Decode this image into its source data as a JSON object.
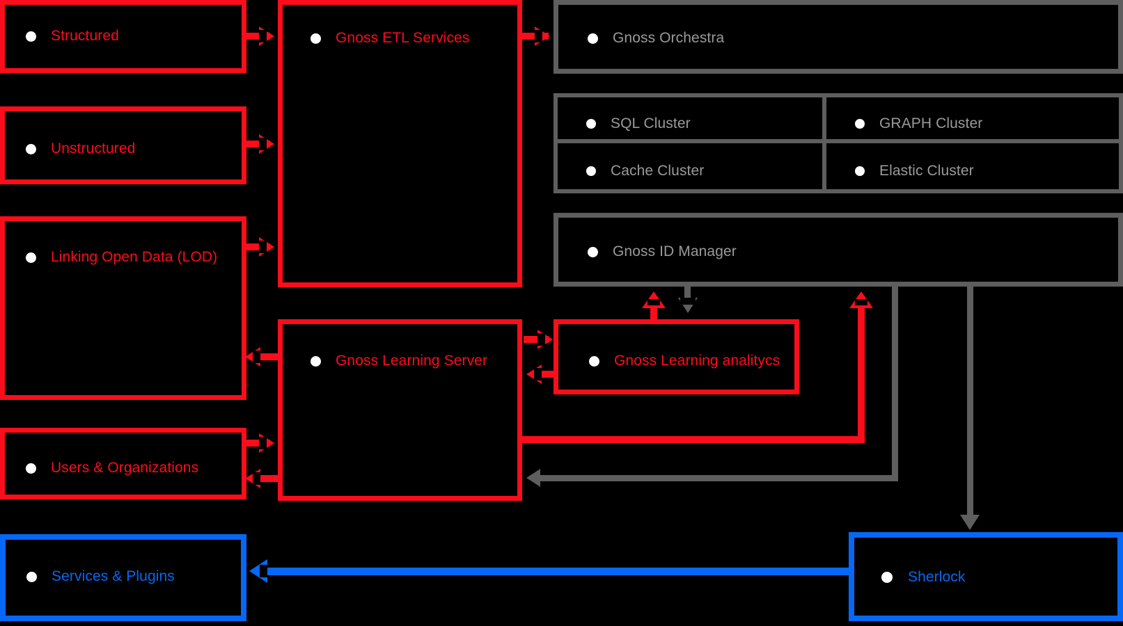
{
  "diagram": {
    "title": "Gnoss platform architecture",
    "background": "#000000",
    "colors": {
      "red": "#fb0d1b",
      "gray": "#5e5e5e",
      "gray_label": "#9a9a9a",
      "blue": "#0668f5",
      "bullet_fill": "#ffffff"
    }
  },
  "nodes": [
    {
      "id": "structured",
      "label": "Structured",
      "color": "red",
      "bullet": "filled-dot-icon"
    },
    {
      "id": "unstructured",
      "label": "Unstructured",
      "color": "red",
      "bullet": "filled-dot-icon"
    },
    {
      "id": "lod",
      "label": "Linking Open Data (LOD)",
      "color": "red",
      "bullet": "filled-dot-icon"
    },
    {
      "id": "users_orgs",
      "label": "Users & Organizations",
      "color": "red",
      "bullet": "filled-dot-icon"
    },
    {
      "id": "services_plugins",
      "label": "Services & Plugins",
      "color": "blue",
      "bullet": "filled-dot-icon"
    },
    {
      "id": "etl",
      "label": "Gnoss ETL Services",
      "color": "red",
      "bullet": "filled-dot-icon"
    },
    {
      "id": "learning_server",
      "label": "Gnoss Learning Server",
      "color": "red",
      "bullet": "filled-dot-icon"
    },
    {
      "id": "learning_analytics",
      "label": "Gnoss Learning analitycs",
      "color": "red",
      "bullet": "filled-dot-icon"
    },
    {
      "id": "orchestra",
      "label": "Gnoss Orchestra",
      "color": "gray",
      "bullet": "filled-dot-icon"
    },
    {
      "id": "sql_cluster",
      "label": "SQL Cluster",
      "color": "gray",
      "bullet": "filled-dot-icon"
    },
    {
      "id": "graph_cluster",
      "label": "GRAPH Cluster",
      "color": "gray",
      "bullet": "filled-dot-icon"
    },
    {
      "id": "cache_cluster",
      "label": "Cache Cluster",
      "color": "gray",
      "bullet": "filled-dot-icon"
    },
    {
      "id": "elastic_cluster",
      "label": "Elastic Cluster",
      "color": "gray",
      "bullet": "filled-dot-icon"
    },
    {
      "id": "id_manager",
      "label": "Gnoss ID Manager",
      "color": "gray",
      "bullet": "filled-dot-icon"
    },
    {
      "id": "sherlock",
      "label": "Sherlock",
      "color": "blue",
      "bullet": "filled-dot-icon"
    }
  ],
  "edges": [
    {
      "from": "structured",
      "to": "etl",
      "color": "red",
      "direction": "right"
    },
    {
      "from": "unstructured",
      "to": "etl",
      "color": "red",
      "direction": "right"
    },
    {
      "from": "lod",
      "to": "etl",
      "color": "red",
      "direction": "right"
    },
    {
      "from": "etl",
      "to": "orchestra",
      "color": "red",
      "direction": "right"
    },
    {
      "from": "learning_server",
      "to": "lod",
      "color": "red",
      "direction": "left"
    },
    {
      "from": "users_orgs",
      "to": "learning_server",
      "color": "red",
      "direction": "right"
    },
    {
      "from": "learning_server",
      "to": "users_orgs",
      "color": "red",
      "direction": "left"
    },
    {
      "from": "learning_server",
      "to": "learning_analytics",
      "color": "red",
      "direction": "right"
    },
    {
      "from": "learning_analytics",
      "to": "learning_server",
      "color": "red",
      "direction": "left"
    },
    {
      "from": "learning_analytics",
      "to": "id_manager",
      "color": "red",
      "direction": "up"
    },
    {
      "from": "id_manager",
      "to": "learning_analytics",
      "color": "gray",
      "direction": "down"
    },
    {
      "from": "learning_server",
      "to": "id_manager",
      "color": "red",
      "direction": "up"
    },
    {
      "from": "id_manager",
      "to": "learning_server",
      "color": "gray",
      "direction": "left"
    },
    {
      "from": "id_manager",
      "to": "sherlock",
      "color": "gray",
      "direction": "down"
    },
    {
      "from": "sherlock",
      "to": "services_plugins",
      "color": "blue",
      "direction": "left"
    }
  ]
}
